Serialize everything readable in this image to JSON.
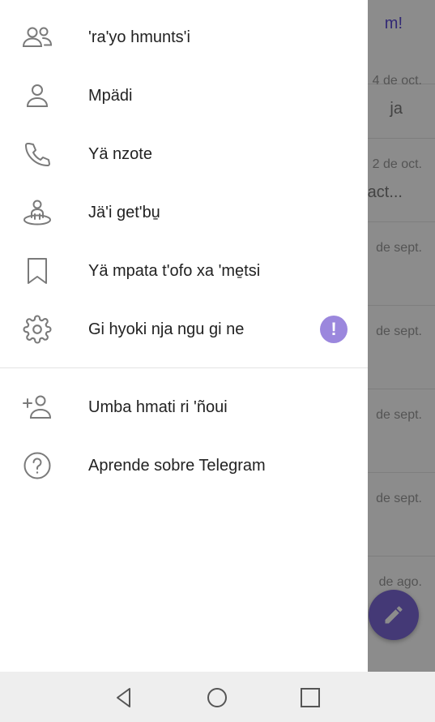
{
  "background": {
    "rows": [
      {
        "date": "",
        "preview": "m!"
      },
      {
        "date": "4 de oct.",
        "preview": "ja"
      },
      {
        "date": "2 de oct.",
        "preview": "act..."
      },
      {
        "date": "de sept.",
        "preview": ""
      },
      {
        "date": "de sept.",
        "preview": ""
      },
      {
        "date": "de sept.",
        "preview": ""
      },
      {
        "date": "de sept.",
        "preview": ""
      },
      {
        "date": "de ago.",
        "preview": ""
      }
    ]
  },
  "drawer": {
    "items": [
      {
        "label": "'ra'yo hmunts'i",
        "icon": "group-icon"
      },
      {
        "label": "Mpädi",
        "icon": "person-icon"
      },
      {
        "label": "Yä nzote",
        "icon": "phone-icon"
      },
      {
        "label": "Jä'i get'bu̱",
        "icon": "people-nearby-icon"
      },
      {
        "label": "Yä mpata t'ofo xa 'me̱tsi",
        "icon": "bookmark-icon"
      },
      {
        "label": "Gi hyoki nja ngu gi ne",
        "icon": "gear-icon",
        "badge": "!"
      }
    ],
    "secondary_items": [
      {
        "label": "Umba hmati ri 'ñoui",
        "icon": "add-person-icon"
      },
      {
        "label": "Aprende sobre Telegram",
        "icon": "question-icon"
      }
    ]
  },
  "colors": {
    "accent": "#7d68d8",
    "badge": "#9b87dd",
    "icon": "#7a7a7a"
  }
}
